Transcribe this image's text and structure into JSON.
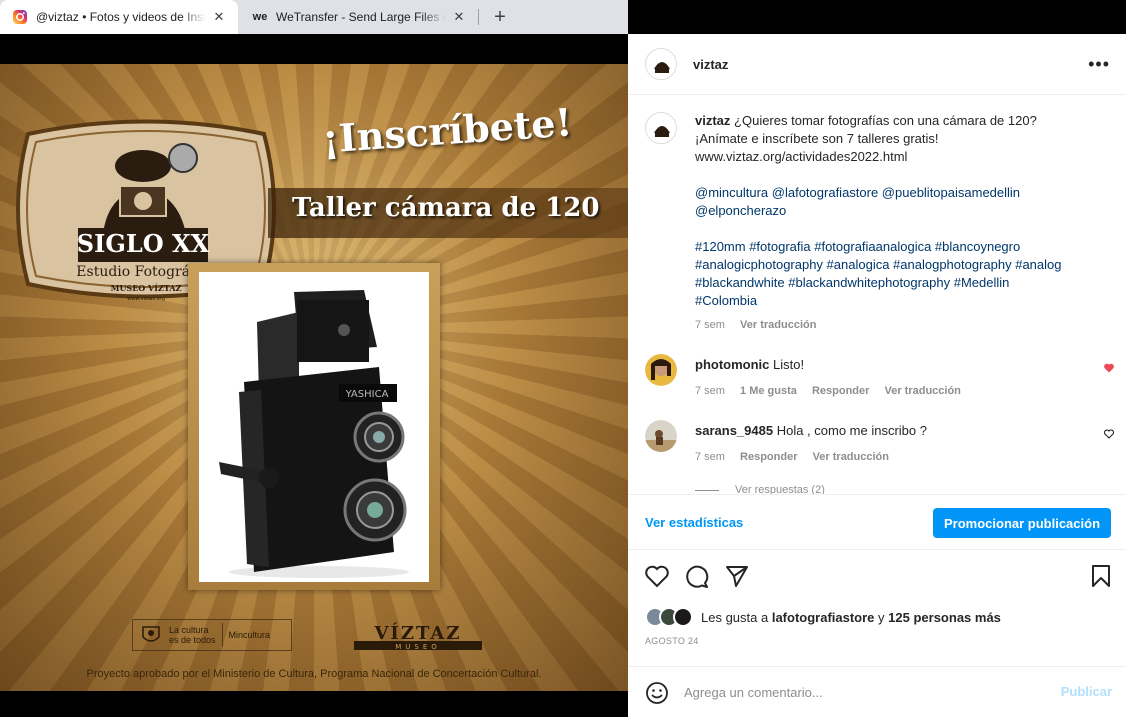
{
  "browser": {
    "tabs": [
      {
        "title": "@viztaz • Fotos y videos de Instagram",
        "favicon": "instagram-icon",
        "active": true
      },
      {
        "title": "WeTransfer - Send Large Files & Share",
        "favicon": "wetransfer-icon",
        "active": false
      }
    ],
    "new_tab_label": "+",
    "close_label": "✕"
  },
  "post_image": {
    "logo": {
      "line1": "SIGLO XX",
      "line2": "Estudio Fotográfico",
      "line3": "MUSEO VÍZTAZ",
      "line4": "www.viztaz.org"
    },
    "headline": "¡Inscríbete!",
    "subheadline": "Taller cámara de 120",
    "camera_brand": "YASHICA",
    "footer_logo_a_line1": "La cultura",
    "footer_logo_a_line2": "es de todos",
    "footer_logo_a_line3": "Mincultura",
    "footer_logo_b_line1": "VÍZTAZ",
    "footer_logo_b_line2": "MUSEO",
    "footer_text": "Proyecto aprobado por el Ministerio de Cultura, Programa Nacional de Concertación Cultural."
  },
  "panel": {
    "username": "viztaz",
    "more_label": "•••",
    "caption": {
      "username": "viztaz",
      "text_line1": "¿Quieres tomar fotografías con una cámara de 120?",
      "text_line2": "¡Anímate e inscríbete son 7 talleres gratis!",
      "text_line3": "www.viztaz.org/actividades2022.html",
      "mentions_line1": "@mincultura @lafotografiastore @pueblitopaisamedellin",
      "mentions_line2": "@elponcherazo",
      "tags_line1": "#120mm #fotografia #fotografiaanalogica #blancoynegro",
      "tags_line2": "#analogicphotography #analogica #analogphotography #analog",
      "tags_line3": "#blackandwhite #blackandwhitephotography #Medellin",
      "tags_line4": "#Colombia",
      "time": "7 sem",
      "translate": "Ver traducción"
    },
    "comments": [
      {
        "username": "photomonic",
        "text": "Listo!",
        "time": "7 sem",
        "likes": "1 Me gusta",
        "reply": "Responder",
        "translate": "Ver traducción",
        "liked": true
      },
      {
        "username": "sarans_9485",
        "text": "Hola , como me inscribo ?",
        "time": "7 sem",
        "reply": "Responder",
        "translate": "Ver traducción",
        "liked": false
      }
    ],
    "view_replies": "Ver respuestas (2)",
    "insights_label": "Ver estadísticas",
    "promote_label": "Promocionar publicación",
    "likes": {
      "prefix": "Les gusta a",
      "user": "lafotografiastore",
      "connector": "y",
      "others": "125 personas más"
    },
    "date": "AGOSTO 24",
    "comment_placeholder": "Agrega un comentario...",
    "publish_label": "Publicar"
  },
  "colors": {
    "accent": "#0095f6",
    "heart": "#ed4956",
    "text": "#262626",
    "muted": "#8e8e8e",
    "link": "#00376b"
  }
}
